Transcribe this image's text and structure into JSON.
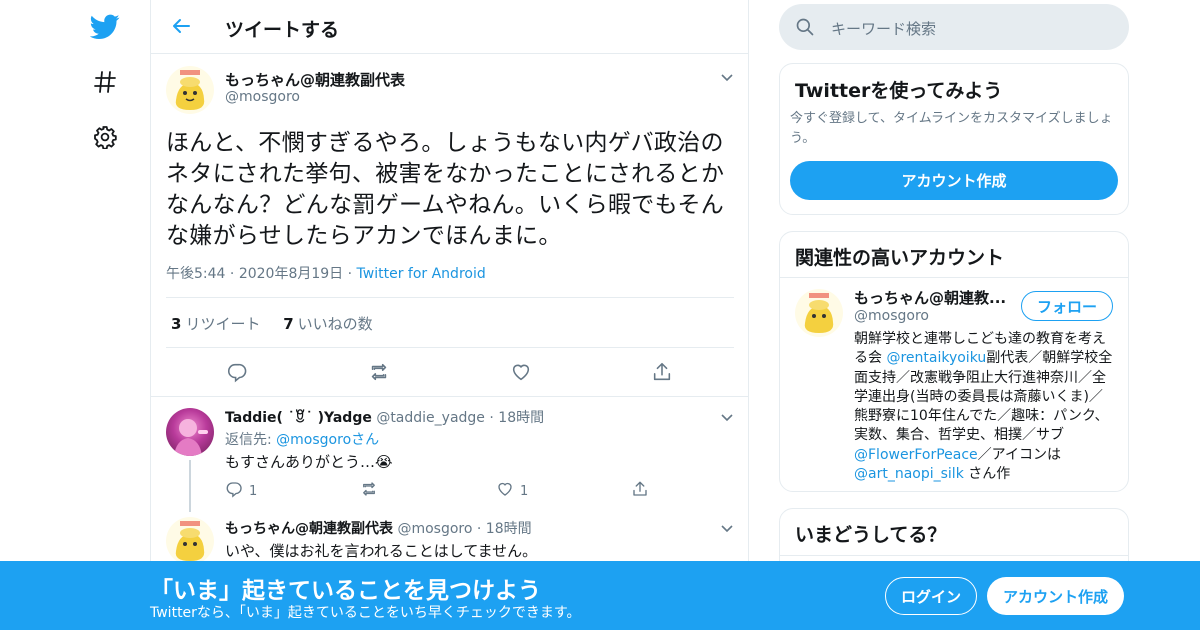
{
  "header": {
    "title": "ツイートする"
  },
  "tweet": {
    "author_name": "もっちゃん@朝連教副代表",
    "author_handle": "@mosgoro",
    "text": "ほんと、不憫すぎるやろ。しょうもない内ゲバ政治のネタにされた挙句、被害をなかったことにされるとかなんなん？どんな罰ゲームやねん。いくら暇でもそんな嫌がらせしたらアカンでほんまに。",
    "time": "午後5:44",
    "date": "2020年8月19日",
    "client": "Twitter for Android",
    "retweets_count": "3",
    "retweets_label": "リツイート",
    "likes_count": "7",
    "likes_label": "いいねの数"
  },
  "replies": [
    {
      "name": "Taddie( ˙ꆚ˙ )Yadge",
      "handle": "@taddie_yadge",
      "time": "18時間",
      "reply_to_prefix": "返信先: ",
      "reply_to_handle": "@mosgoro",
      "reply_to_suffix": "さん",
      "text": "もすさんありがとう…😭",
      "reply_count": "1",
      "like_count": "1"
    },
    {
      "name": "もっちゃん@朝連教副代表",
      "handle": "@mosgoro",
      "time": "18時間",
      "text": "いや、僕はお礼を言われることはしてません。"
    }
  ],
  "search": {
    "placeholder": "キーワード検索"
  },
  "signup_card": {
    "title": "Twitterを使ってみよう",
    "desc": "今すぐ登録して、タイムラインをカスタマイズしましょう。",
    "button": "アカウント作成"
  },
  "related": {
    "title": "関連性の高いアカウント",
    "name": "もっちゃん@朝連教...",
    "handle": "@mosgoro",
    "follow": "フォロー",
    "bio_parts": [
      {
        "t": "朝鮮学校と連帯しこども達の教育を考える会 ",
        "link": false
      },
      {
        "t": "@rentaikyoiku",
        "link": true
      },
      {
        "t": "副代表／朝鮮学校全面支持／改憲戦争阻止大行進神奈川／全学連出身(当時の委員長は斎藤いくま)／熊野寮に10年住んでた／趣味：パンク、実数、集合、哲学史、相撲／サブ",
        "link": false
      },
      {
        "t": "@FlowerForPeace",
        "link": true
      },
      {
        "t": "／アイコンは ",
        "link": false
      },
      {
        "t": "@art_naopi_silk",
        "link": true
      },
      {
        "t": " さん作",
        "link": false
      }
    ]
  },
  "trends": {
    "title": "いまどうしてる？"
  },
  "banner": {
    "title": "「いま」起きていることを見つけよう",
    "subtitle": "Twitterなら、「いま」起きていることをいち早くチェックできます。",
    "login": "ログイン",
    "signup": "アカウント作成"
  },
  "colors": {
    "accent": "#1da1f2",
    "link": "#1b95e0",
    "muted": "#657786",
    "border": "#e6ecf0"
  }
}
